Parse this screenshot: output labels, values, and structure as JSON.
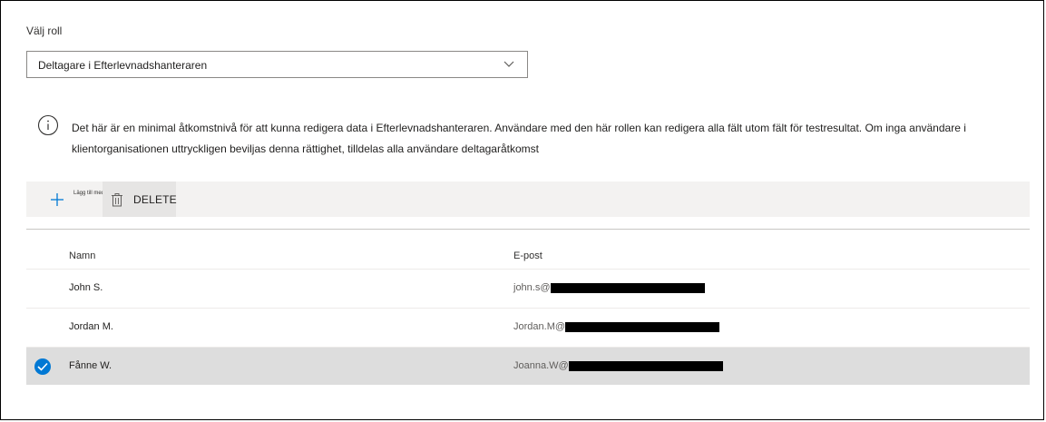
{
  "role": {
    "label": "Välj roll",
    "selected": "Deltagare i Efterlevnadshanteraren"
  },
  "info": {
    "text": "Det här är en minimal åtkomstnivå för att kunna redigera data i Efterlevnadshanteraren. Användare med den här rollen kan redigera alla fält utom fält för testresultat. Om inga användare i klientorganisationen uttryckligen beviljas denna rättighet, tilldelas alla användare deltagaråtkomst"
  },
  "toolbar": {
    "add_label": "Lägg till medlemmar",
    "delete_label": "DELETE"
  },
  "table": {
    "headers": {
      "name": "Namn",
      "email": "E-post"
    },
    "rows": [
      {
        "name": "John S.",
        "email": "john.s@",
        "selected": false
      },
      {
        "name": "Jordan M.",
        "email": "Jordan.M@",
        "selected": false
      },
      {
        "name": "Fånne W.",
        "email": "Joanna.W@",
        "selected": true
      }
    ]
  },
  "colors": {
    "accent": "#0078d4",
    "selected_row": "#dddddd",
    "toolbar_bg": "#f3f2f1"
  }
}
